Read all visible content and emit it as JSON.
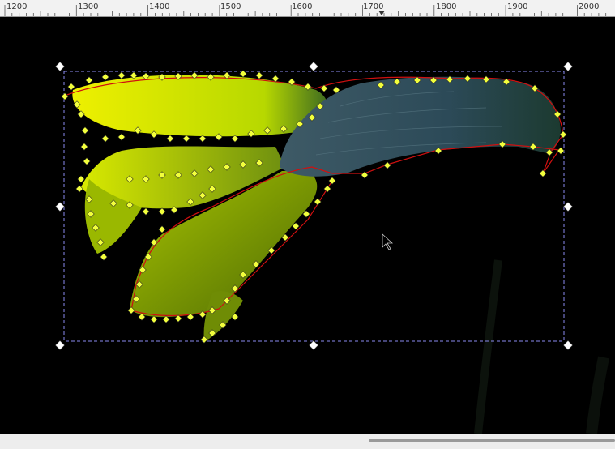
{
  "ruler": {
    "ticks": [
      "1200",
      "1300",
      "1400",
      "1500",
      "1600",
      "1700",
      "1800",
      "1900",
      "2000"
    ]
  },
  "canvas": {
    "background_color": "#000000",
    "petal_colors": [
      "#e6f000",
      "#b9d200",
      "#8fb000"
    ],
    "bud_color": "#2f4a55",
    "path_stroke_color": "#ff0000",
    "node_color": "#f2ff3c",
    "selection_box_color": "#8a8af0"
  },
  "icons": {
    "handles": "double-arrow-icon",
    "cursor": "arrow-cursor-icon"
  }
}
